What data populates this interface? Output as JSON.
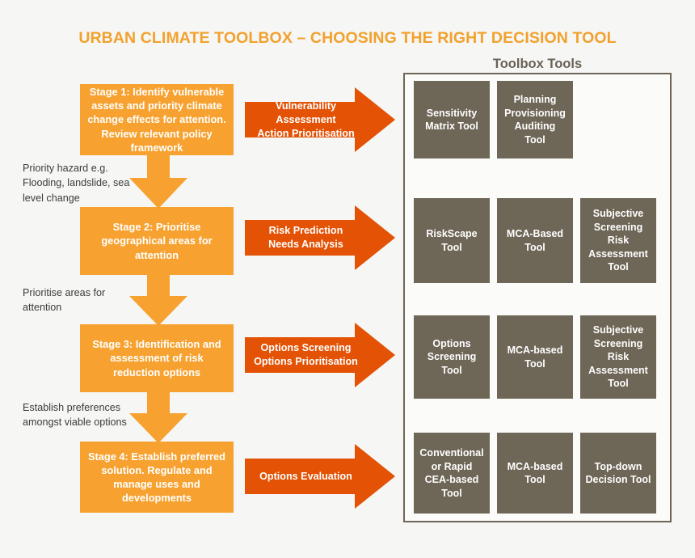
{
  "title": "URBAN CLIMATE TOOLBOX – CHOOSING THE RIGHT DECISION TOOL",
  "toolbox": {
    "heading": "Toolbox Tools"
  },
  "colors": {
    "title_orange": "#f2a12c",
    "stage_orange": "#f7a230",
    "arrow_orange": "#e35205",
    "tool_brown": "#6e6656",
    "frame_brown": "#6f6557",
    "background": "#f6f6f5",
    "note_text": "#3b3b3b"
  },
  "stages": [
    {
      "id": "stage-1",
      "label": "Stage 1: Identify vulnerable assets and priority climate change effects for attention. Review relevant policy framework"
    },
    {
      "id": "stage-2",
      "label": "Stage 2: Prioritise geographical areas for attention"
    },
    {
      "id": "stage-3",
      "label": "Stage 3: Identification and assessment of risk reduction options"
    },
    {
      "id": "stage-4",
      "label": "Stage 4: Establish preferred solution. Regulate and manage uses and developments"
    }
  ],
  "process_arrows": [
    {
      "id": "arrow-1",
      "label": "Vulnerability Assessment\nAction Prioritisation"
    },
    {
      "id": "arrow-2",
      "label": "Risk Prediction\nNeeds Analysis"
    },
    {
      "id": "arrow-3",
      "label": "Options Screening\nOptions Prioritisation"
    },
    {
      "id": "arrow-4",
      "label": "Options Evaluation"
    }
  ],
  "notes": [
    {
      "id": "note-1",
      "text": "Priority hazard e.g.\nFlooding, landslide, sea\nlevel change"
    },
    {
      "id": "note-2",
      "text": "Prioritise areas for\nattention"
    },
    {
      "id": "note-3",
      "text": "Establish preferences\namongst viable options"
    }
  ],
  "tool_rows": [
    {
      "id": "tool-row-1",
      "tools": [
        {
          "label": "Sensitivity\nMatrix Tool"
        },
        {
          "label": "Planning\nProvisioning\nAuditing\nTool"
        }
      ]
    },
    {
      "id": "tool-row-2",
      "tools": [
        {
          "label": "RiskScape\nTool"
        },
        {
          "label": "MCA-Based\nTool"
        },
        {
          "label": "Subjective\nScreening\nRisk\nAssessment\nTool"
        }
      ]
    },
    {
      "id": "tool-row-3",
      "tools": [
        {
          "label": "Options\nScreening\nTool"
        },
        {
          "label": "MCA-based\nTool"
        },
        {
          "label": "Subjective\nScreening\nRisk\nAssessment\nTool"
        }
      ]
    },
    {
      "id": "tool-row-4",
      "tools": [
        {
          "label": "Conventional\nor Rapid\nCEA-based\nTool"
        },
        {
          "label": "MCA-based\nTool"
        },
        {
          "label": "Top-down\nDecision Tool"
        }
      ]
    }
  ]
}
